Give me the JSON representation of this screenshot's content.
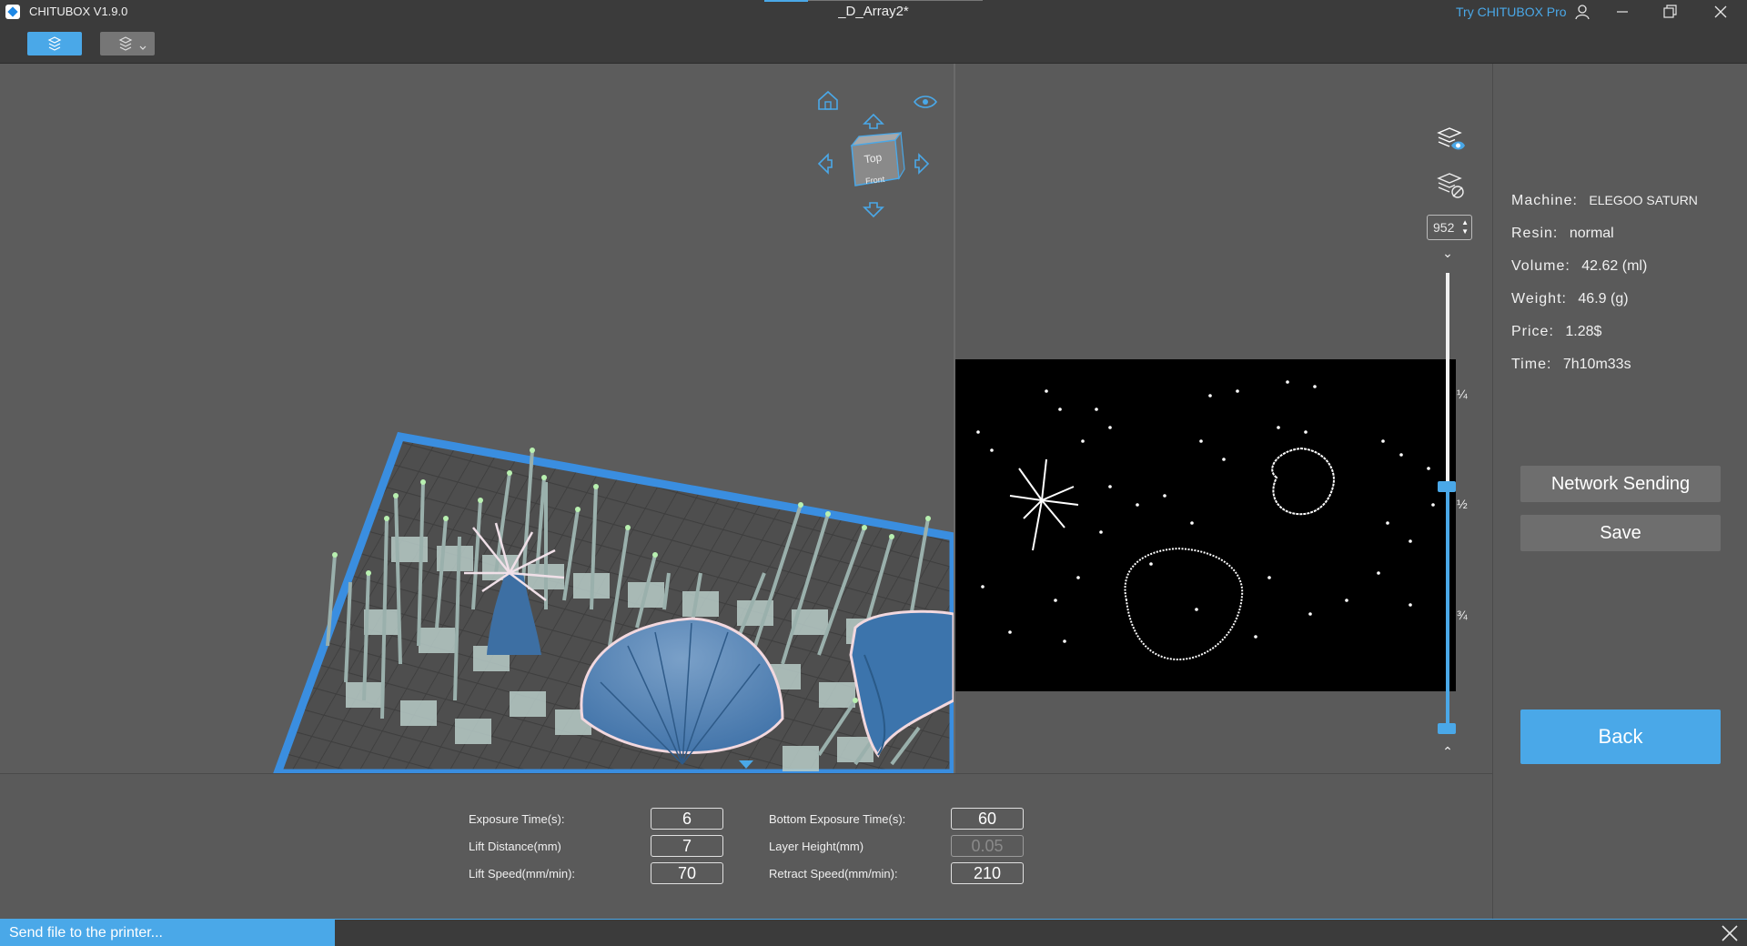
{
  "titlebar": {
    "app_name": "CHITUBOX V1.9.0",
    "document_title": "_D_Array2*",
    "pro_link": "Try CHITUBOX Pro",
    "icons": [
      "user-icon",
      "minimize-icon",
      "restore-icon",
      "close-icon"
    ]
  },
  "toolbar": {
    "tools": [
      "slice-tool-icon",
      "layers-tool-icon"
    ]
  },
  "view_cube": {
    "top_label": "Top",
    "front_label": "Front",
    "icons": [
      "home-icon",
      "eye-icon",
      "arrow-up-icon",
      "arrow-down-icon",
      "arrow-left-icon",
      "arrow-right-icon"
    ]
  },
  "layer_slider": {
    "current_layer": "952",
    "tick_labels": [
      "¼",
      "½",
      "¾"
    ],
    "position_fraction": 0.5,
    "icons": [
      "layer-visible-icon",
      "layer-hidden-icon"
    ]
  },
  "info": {
    "machine": {
      "label": "Machine:",
      "value": "ELEGOO SATURN"
    },
    "resin": {
      "label": "Resin:",
      "value": "normal"
    },
    "volume": {
      "label": "Volume:",
      "value": "42.62  (ml)"
    },
    "weight": {
      "label": "Weight:",
      "value": "46.9  (g)"
    },
    "price": {
      "label": "Price:",
      "value": "1.28$"
    },
    "time": {
      "label": "Time:",
      "value": "7h10m33s"
    }
  },
  "actions": {
    "network_sending": "Network Sending",
    "save": "Save",
    "back": "Back"
  },
  "settings": {
    "exposure_time": {
      "label": "Exposure Time(s):",
      "value": "6"
    },
    "lift_distance": {
      "label": "Lift Distance(mm)",
      "value": "7"
    },
    "lift_speed": {
      "label": "Lift Speed(mm/min):",
      "value": "70"
    },
    "bottom_exposure_time": {
      "label": "Bottom Exposure Time(s):",
      "value": "60"
    },
    "layer_height": {
      "label": "Layer Height(mm)",
      "value": "0.05"
    },
    "retract_speed": {
      "label": "Retract Speed(mm/min):",
      "value": "210"
    }
  },
  "status": {
    "message": "Send file to the printer..."
  },
  "colors": {
    "accent": "#4aa8e8",
    "panel": "#5a5a5a",
    "titlebar": "#3b3b3b"
  }
}
